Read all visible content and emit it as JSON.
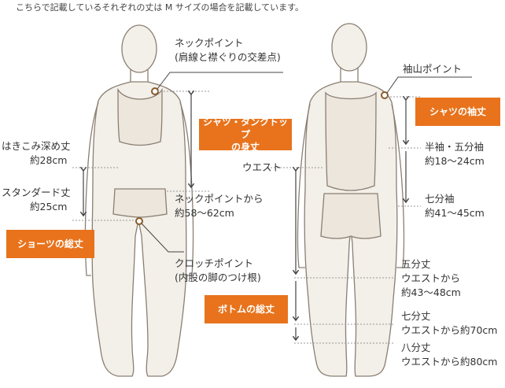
{
  "note": "こちらで記載しているそれぞれの丈は M サイズの場合を記載しています。",
  "front": {
    "neck_point": {
      "title": "ネックポイント",
      "sub": "(肩線と襟ぐりの交差点)"
    },
    "shirt_length_badge": {
      "line1": "シャツ・タンクトップ",
      "line2": "の身丈"
    },
    "shirt_length_value": {
      "title": "ネックポイントから",
      "value": "約58～62cm"
    },
    "deep_rise": {
      "title": "はきこみ深め丈",
      "value": "約28cm"
    },
    "standard_rise": {
      "title": "スタンダード丈",
      "value": "約25cm"
    },
    "shorts_badge": "ショーツの総丈",
    "crotch_point": {
      "title": "クロッチポイント",
      "sub": "(内股の脚のつけ根)"
    }
  },
  "back": {
    "sleeve_point": "袖山ポイント",
    "sleeve_badge": "シャツの袖丈",
    "half_sleeve": {
      "title": "半袖・五分袖",
      "value": "約18～24cm"
    },
    "three_quarter_sleeve": {
      "title": "七分袖",
      "value": "約41～45cm"
    },
    "waist": "ウエスト",
    "bottoms_badge": "ボトムの総丈",
    "half_length": {
      "title": "五分丈",
      "sub": "ウエストから",
      "value": "約43～48cm"
    },
    "seven_length": {
      "title": "七分丈",
      "value": "ウエストから約70cm"
    },
    "eight_length": {
      "title": "八分丈",
      "value": "ウエストから約80cm"
    }
  },
  "colors": {
    "accent": "#e8731c",
    "line": "#555555",
    "figure_stroke": "#8a7f72",
    "figure_fill": "#f3efe9"
  }
}
